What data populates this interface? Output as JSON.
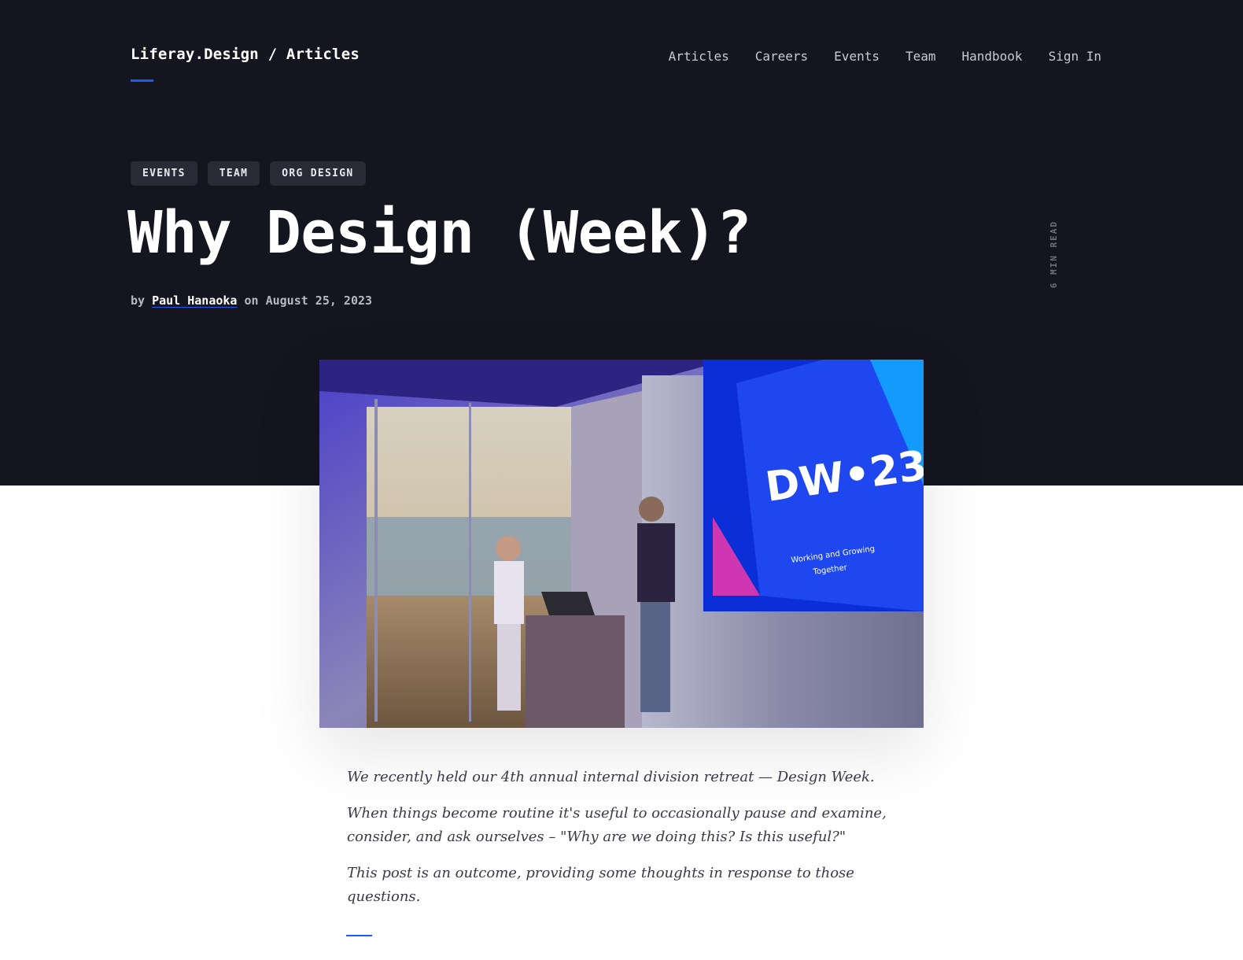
{
  "header": {
    "brand": "Liferay.Design / Articles",
    "nav": [
      "Articles",
      "Careers",
      "Events",
      "Team",
      "Handbook",
      "Sign In"
    ]
  },
  "article": {
    "tags": [
      "EVENTS",
      "TEAM",
      "ORG DESIGN"
    ],
    "title": "Why Design (Week)?",
    "byline_prefix": "by",
    "author": "Paul Hanaoka",
    "byline_mid": "on",
    "date": "August 25, 2023",
    "read_time": "6 MIN READ",
    "photo": {
      "screen_title": "DW•23",
      "screen_subtitle_line1": "Working and Growing",
      "screen_subtitle_line2": "Together"
    },
    "excerpt": [
      "We recently held our 4th annual internal division retreat — Design Week.",
      "When things become routine it's useful to occasionally pause and examine, consider, and ask ourselves – \"Why are we doing this? Is this useful?\"",
      "This post is an outcome, providing some thoughts in response to those questions."
    ]
  },
  "colors": {
    "hero_bg": "#151520",
    "accent": "#1a5cf0",
    "tag_bg": "#2a2a36"
  }
}
